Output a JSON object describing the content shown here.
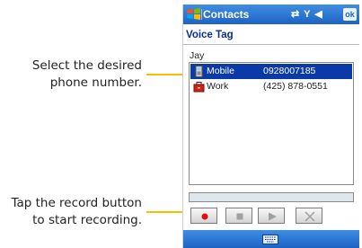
{
  "callouts": {
    "select_number": "Select the desired phone number.",
    "record_hint": "Tap the record button to start recording."
  },
  "titlebar": {
    "app_title": "Contacts",
    "ok_label": "ok"
  },
  "screen": {
    "heading": "Voice Tag",
    "contact_name": "Jay",
    "numbers": [
      {
        "label": "Mobile",
        "value": "0928007185",
        "icon": "mobile-phone-icon",
        "selected": true
      },
      {
        "label": "Work",
        "value": "(425) 878-0551",
        "icon": "work-briefcase-icon",
        "selected": false
      }
    ]
  },
  "controls": [
    "record",
    "stop",
    "play",
    "delete"
  ],
  "colors": {
    "accent": "#1e63c4",
    "highlight": "#0a3aa8",
    "callout_line": "#f2c200",
    "record_red": "#e01010"
  }
}
